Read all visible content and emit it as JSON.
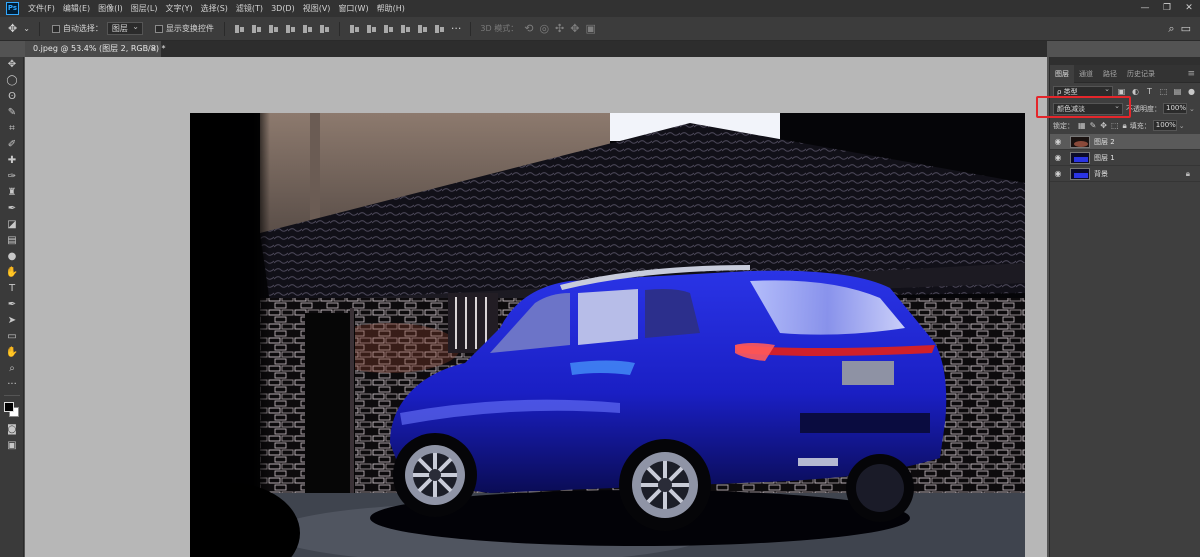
{
  "app": {
    "logo": "Ps"
  },
  "menu": [
    "文件(F)",
    "编辑(E)",
    "图像(I)",
    "图层(L)",
    "文字(Y)",
    "选择(S)",
    "滤镜(T)",
    "3D(D)",
    "视图(V)",
    "窗口(W)",
    "帮助(H)"
  ],
  "window_controls": {
    "minimize": "—",
    "restore": "❐",
    "close": "✕"
  },
  "options": {
    "auto_select_label": "自动选择：",
    "auto_select_value": "图层",
    "show_transform_label": "显示变换控件",
    "mode_3d_label": "3D 模式："
  },
  "document": {
    "tab_title": "0.jpeg @ 53.4% (图层 2, RGB/8) *",
    "close": "×"
  },
  "panel": {
    "tabs": [
      "图层",
      "通道",
      "路径",
      "历史记录"
    ],
    "filter_value": "ρ 类型",
    "blend_mode": "颜色减淡",
    "opacity_label": "不透明度：",
    "opacity_value": "100%",
    "lock_label": "锁定：",
    "fill_label": "填充：",
    "fill_value": "100%",
    "layers": [
      {
        "name": "图层 2",
        "selected": true,
        "locked": false
      },
      {
        "name": "图层 1",
        "selected": false,
        "locked": false
      },
      {
        "name": "背景",
        "selected": false,
        "locked": true
      }
    ]
  },
  "colors": {
    "highlight_box": "#e4262b",
    "car_body": "#1a1fc4",
    "tail_light": "#d0202a"
  }
}
